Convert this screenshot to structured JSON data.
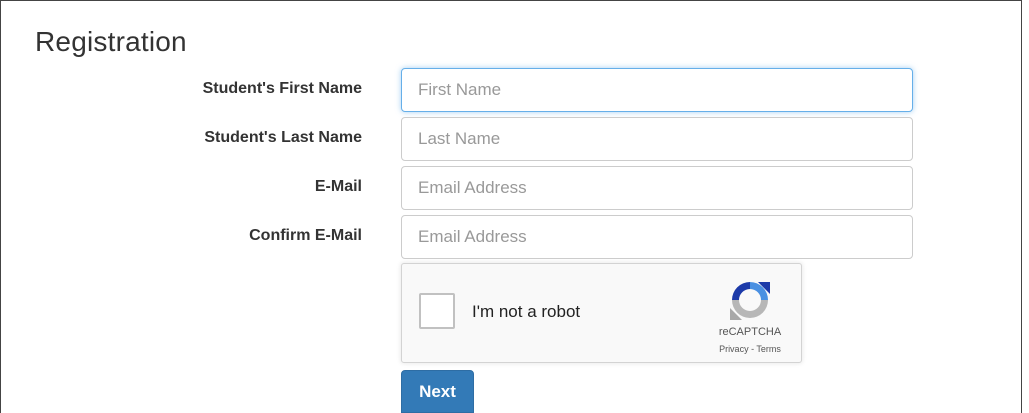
{
  "form": {
    "title": "Registration",
    "fields": [
      {
        "label": "Student's First Name",
        "placeholder": "First Name",
        "value": ""
      },
      {
        "label": "Student's Last Name",
        "placeholder": "Last Name",
        "value": ""
      },
      {
        "label": "E-Mail",
        "placeholder": "Email Address",
        "value": ""
      },
      {
        "label": "Confirm E-Mail",
        "placeholder": "Email Address",
        "value": ""
      }
    ],
    "captcha": {
      "text": "I'm not a robot",
      "brand": "reCAPTCHA",
      "privacy": "Privacy",
      "separator": " - ",
      "terms": "Terms",
      "icon": "recaptcha-icon"
    },
    "next_label": "Next"
  },
  "colors": {
    "primary": "#337ab7",
    "focus_border": "#66afe9",
    "label_text": "#333333",
    "placeholder": "#999999"
  }
}
